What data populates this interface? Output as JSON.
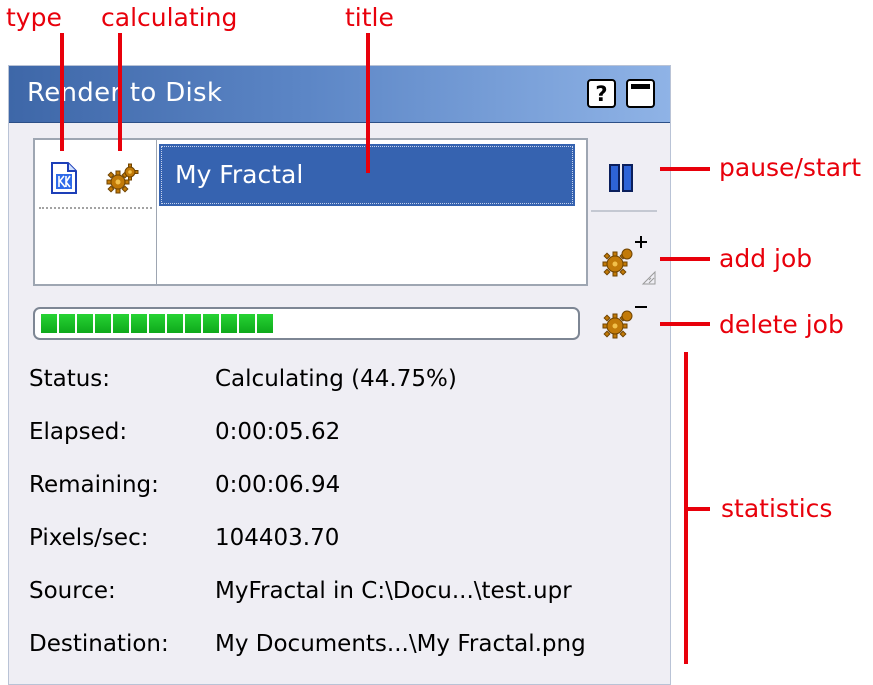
{
  "annotations": {
    "type": "type",
    "calculating": "calculating",
    "title": "title",
    "pause_start": "pause/start",
    "add_job": "add job",
    "delete_job": "delete job",
    "statistics": "statistics"
  },
  "window": {
    "title": "Render to Disk",
    "help_label": "?"
  },
  "job": {
    "title": "My Fractal",
    "type_icon": "document-icon",
    "status_icon": "gear-icon"
  },
  "progress": {
    "fraction": 0.4475,
    "color": "#18c025"
  },
  "stats": {
    "status_label": "Status:",
    "status_value": "Calculating (44.75%)",
    "elapsed_label": "Elapsed:",
    "elapsed_value": "0:00:05.62",
    "remaining_label": "Remaining:",
    "remaining_value": "0:00:06.94",
    "pixels_label": "Pixels/sec:",
    "pixels_value": "104403.70",
    "source_label": "Source:",
    "source_value": "MyFractal in C:\\Docu...\\test.upr",
    "destination_label": "Destination:",
    "destination_value": "My Documents...\\My Fractal.png"
  },
  "colors": {
    "annotation": "#e8000b",
    "titlebar": "#4f79bb",
    "selection": "#3663b0"
  }
}
